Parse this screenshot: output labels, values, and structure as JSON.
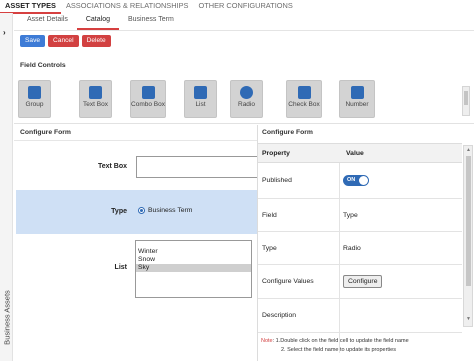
{
  "top_tabs": [
    "ASSET TYPES",
    "ASSOCIATIONS & RELATIONSHIPS",
    "OTHER CONFIGURATIONS"
  ],
  "left_rail": {
    "label": "Business Assets"
  },
  "sub_tabs": [
    "Asset Details",
    "Catalog",
    "Business Term"
  ],
  "actions": {
    "save": "Save",
    "cancel": "Cancel",
    "delete": "Delete"
  },
  "field_controls": {
    "title": "Field Controls",
    "items": [
      {
        "label": "Group",
        "icon": "group-icon"
      },
      {
        "label": "Text Box",
        "icon": "text-box-icon"
      },
      {
        "label": "Combo Box",
        "icon": "combo-box-icon"
      },
      {
        "label": "List",
        "icon": "list-icon"
      },
      {
        "label": "Radio",
        "icon": "radio-icon"
      },
      {
        "label": "Check Box",
        "icon": "check-box-icon"
      },
      {
        "label": "Number",
        "icon": "number-icon"
      }
    ]
  },
  "configure_form": {
    "title": "Configure Form",
    "textbox_label": "Text Box",
    "textbox_value": "",
    "type_label": "Type",
    "type_option": "Business Term",
    "list_label": "List",
    "list_options": [
      "Winter",
      "Snow",
      "Sky"
    ],
    "list_selected": "Sky"
  },
  "properties_panel": {
    "title": "Configure Form",
    "header_property": "Property",
    "header_value": "Value",
    "published_key": "Published",
    "published_toggle": "ON",
    "field_key": "Field",
    "field_value": "Type",
    "type_key": "Type",
    "type_value": "Radio",
    "configure_values_key": "Configure Values",
    "configure_button": "Configure",
    "description_key": "Description",
    "description_value": ""
  },
  "note": {
    "label": "Note",
    "line1": ": 1.Double click on the field cell to update the field name",
    "line2": "2. Select the field name to update its properties"
  },
  "colors": {
    "accent": "#2f6ab5",
    "danger": "#d24141",
    "selected_row": "#cfe0f5"
  }
}
